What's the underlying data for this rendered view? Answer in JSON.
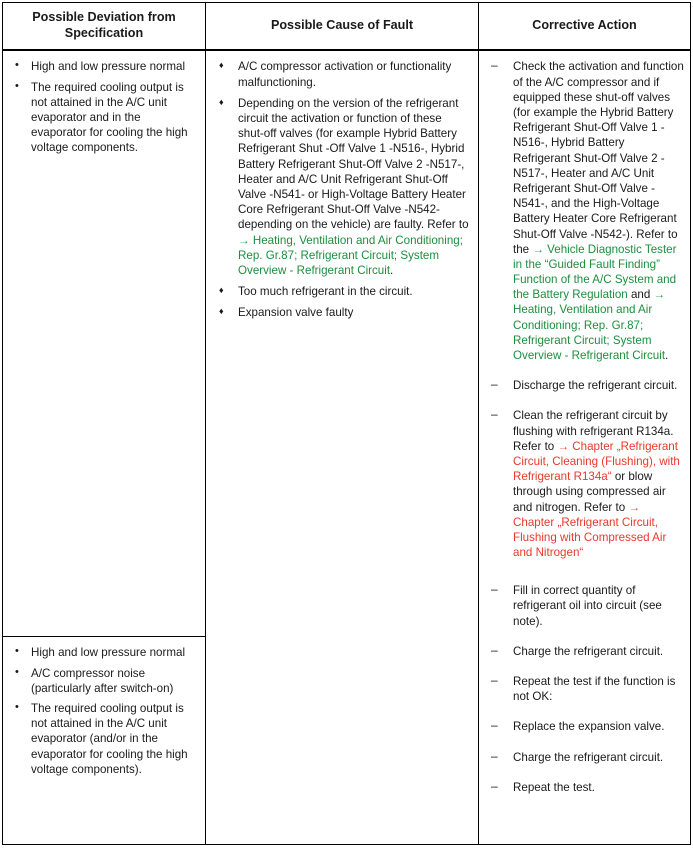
{
  "table": {
    "headers": {
      "col1": "Possible Deviation from Specification",
      "col2": "Possible Cause of Fault",
      "col3": "Corrective Action"
    },
    "colors": {
      "link_green": "#1d8f3e",
      "link_red": "#e8392b",
      "text": "#1a1a1a",
      "border": "#000000"
    },
    "rows": [
      {
        "deviation_bullets": [
          "High and low pressure normal",
          "The required cooling output is not attained in the A/C unit evaporator and in the evaporator for cooling the high voltage components."
        ],
        "cause_bullets": [
          {
            "segments": [
              {
                "text": "A/C compressor activation or functionality malfunctioning.",
                "style": "plain"
              }
            ]
          },
          {
            "segments": [
              {
                "text": "Depending on the version of the refrigerant circuit the activation or function of these shut-off valves (for example Hybrid Battery Refrigerant Shut -Off Valve 1 -N516-, Hybrid Battery Refrigerant Shut-Off Valve 2 -N517-, Heater and A/C Unit Refrigerant Shut-Off Valve -N541- or High-Voltage Battery Heater Core Refrigerant Shut-Off Valve -N542- depending on the vehicle) are faulty. Refer to ",
                "style": "plain"
              },
              {
                "text": "→ Heating, Ventilation and Air Conditioning; Rep. Gr.87; Refrigerant Circuit; System Overview - Refrigerant Circuit",
                "style": "green"
              },
              {
                "text": ".",
                "style": "plain"
              }
            ]
          },
          {
            "segments": [
              {
                "text": "Too much refrigerant in the circuit.",
                "style": "plain"
              }
            ]
          },
          {
            "segments": [
              {
                "text": "Expansion valve faulty",
                "style": "plain"
              }
            ]
          }
        ],
        "action_bullets": [
          {
            "segments": [
              {
                "text": "Check the activation and function of the A/C compressor and if equipped these shut-off valves (for example the Hybrid Battery Refrigerant Shut-Off Valve 1 -N516-, Hybrid Battery Refrigerant Shut-Off Valve 2 -N517-, Heater and A/C Unit Refrigerant Shut-Off Valve -N541-, and the High-Voltage Battery Heater Core Refrigerant Shut-Off Valve -N542-). Refer to the ",
                "style": "plain"
              },
              {
                "text": "→ Vehicle Diagnostic Tester in the “Guided Fault Finding” Function of the A/C System and the Battery Regulation",
                "style": "green"
              },
              {
                "text": " and ",
                "style": "plain"
              },
              {
                "text": "→ Heating, Ventilation and Air Conditioning; Rep. Gr.87; Refrigerant Circuit; System Overview - Refrigerant Circuit",
                "style": "green"
              },
              {
                "text": ".",
                "style": "plain"
              }
            ]
          },
          {
            "segments": [
              {
                "text": "Discharge the refrigerant circuit.",
                "style": "plain"
              }
            ]
          },
          {
            "segments": [
              {
                "text": "Clean the refrigerant circuit by flushing with refrigerant R134a. Refer to ",
                "style": "plain"
              },
              {
                "text": "→ Chapter „Refrigerant Circuit, Cleaning (Flushing), with Refrigerant R134a“",
                "style": "red"
              },
              {
                "text": " or blow through using compressed air and nitrogen. Refer to ",
                "style": "plain"
              },
              {
                "text": "→ Chapter „Refrigerant Circuit, Flushing with Compressed Air and Nitrogen“",
                "style": "red"
              }
            ]
          }
        ]
      },
      {
        "deviation_bullets": [
          "High and low pressure normal",
          "A/C compressor noise (particularly after switch-on)",
          "The required cooling output is not attained in the A/C unit evaporator (and/or in the evaporator for cooling the high voltage components)."
        ],
        "cause_bullets": [],
        "action_bullets": [
          {
            "segments": [
              {
                "text": "Fill in correct quantity of refrigerant oil into circuit (see note).",
                "style": "plain"
              }
            ]
          },
          {
            "segments": [
              {
                "text": "Charge the refrigerant circuit.",
                "style": "plain"
              }
            ]
          },
          {
            "segments": [
              {
                "text": "Repeat the test if the function is not OK:",
                "style": "plain"
              }
            ]
          },
          {
            "segments": [
              {
                "text": "Replace the expansion valve.",
                "style": "plain"
              }
            ]
          },
          {
            "segments": [
              {
                "text": "Charge the refrigerant circuit.",
                "style": "plain"
              }
            ]
          },
          {
            "segments": [
              {
                "text": "Repeat the test.",
                "style": "plain"
              }
            ]
          }
        ]
      }
    ]
  }
}
